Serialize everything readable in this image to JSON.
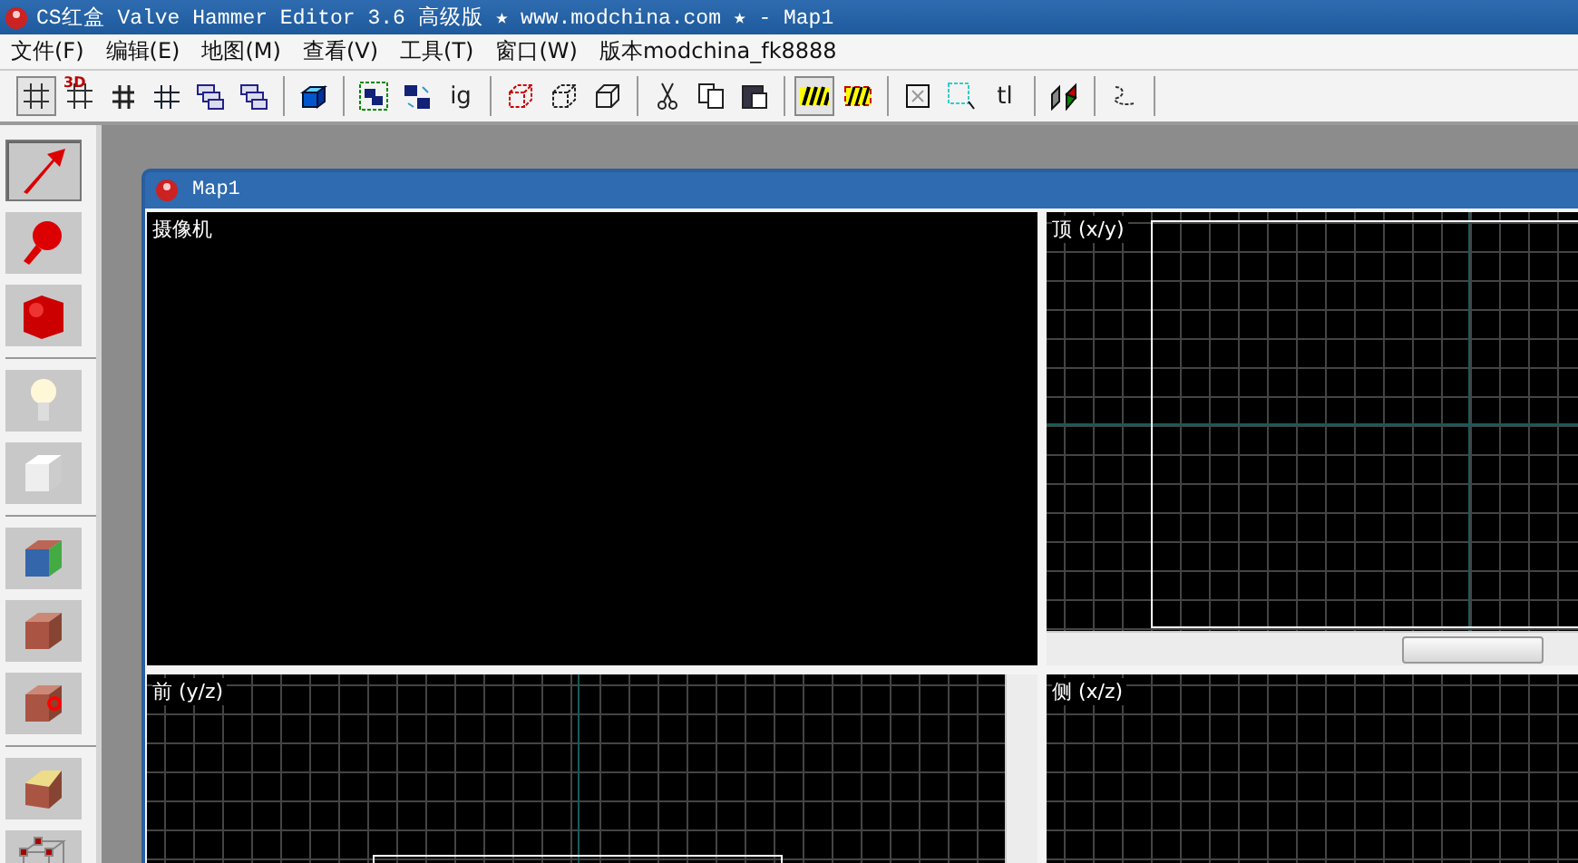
{
  "window": {
    "title": "CS红盒 Valve Hammer Editor 3.6 高级版 ★ www.modchina.com ★ - Map1"
  },
  "menu": [
    {
      "label": "文件(F)"
    },
    {
      "label": "编辑(E)"
    },
    {
      "label": "地图(M)"
    },
    {
      "label": "查看(V)"
    },
    {
      "label": "工具(T)"
    },
    {
      "label": "窗口(W)"
    },
    {
      "label": "版本modchina_fk8888"
    }
  ],
  "toolbar": [
    [
      {
        "kind": "grid",
        "pressed": true
      },
      {
        "kind": "grid3d",
        "label": "3D",
        "pressed": false
      },
      {
        "kind": "gridless",
        "pressed": false
      },
      {
        "kind": "gridmore",
        "pressed": false
      },
      {
        "kind": "stack",
        "pressed": false
      },
      {
        "kind": "stack",
        "pressed": false
      }
    ],
    [
      {
        "kind": "block",
        "pressed": false
      }
    ],
    [
      {
        "kind": "group",
        "pressed": false
      },
      {
        "kind": "ungroup",
        "pressed": false
      },
      {
        "kind": "text",
        "label": "ig"
      }
    ],
    [
      {
        "kind": "carve",
        "pressed": false
      },
      {
        "kind": "hollow",
        "pressed": false
      },
      {
        "kind": "cube",
        "pressed": false
      }
    ],
    [
      {
        "kind": "cut",
        "pressed": false
      },
      {
        "kind": "copy",
        "pressed": false
      },
      {
        "kind": "paste",
        "pressed": false
      }
    ],
    [
      {
        "kind": "hatch",
        "pressed": true
      },
      {
        "kind": "hatchframe",
        "pressed": false
      }
    ],
    [
      {
        "kind": "boxx",
        "pressed": false
      },
      {
        "kind": "select",
        "pressed": false
      },
      {
        "kind": "text",
        "label": "tl"
      }
    ],
    [
      {
        "kind": "faces",
        "pressed": false
      }
    ],
    [
      {
        "kind": "path",
        "pressed": false
      }
    ]
  ],
  "tools": [
    [
      {
        "kind": "arrow",
        "selected": true
      },
      {
        "kind": "magnifier",
        "selected": false
      },
      {
        "kind": "camera",
        "selected": false
      }
    ],
    [
      {
        "kind": "bulb",
        "selected": false
      },
      {
        "kind": "whitecube",
        "selected": false
      }
    ],
    [
      {
        "kind": "texturedcube",
        "selected": false
      },
      {
        "kind": "brickcube",
        "selected": false
      },
      {
        "kind": "targetcube",
        "selected": false
      }
    ],
    [
      {
        "kind": "clippedcube",
        "selected": false
      },
      {
        "kind": "wireframe",
        "selected": false
      }
    ]
  ],
  "map_window": {
    "title": "Map1",
    "viewports": [
      {
        "label": "摄像机",
        "kind": "camera"
      },
      {
        "label": "顶 (x/y)",
        "kind": "grid"
      },
      {
        "label": "前 (y/z)",
        "kind": "grid"
      },
      {
        "label": "侧 (x/z)",
        "kind": "grid"
      }
    ]
  }
}
